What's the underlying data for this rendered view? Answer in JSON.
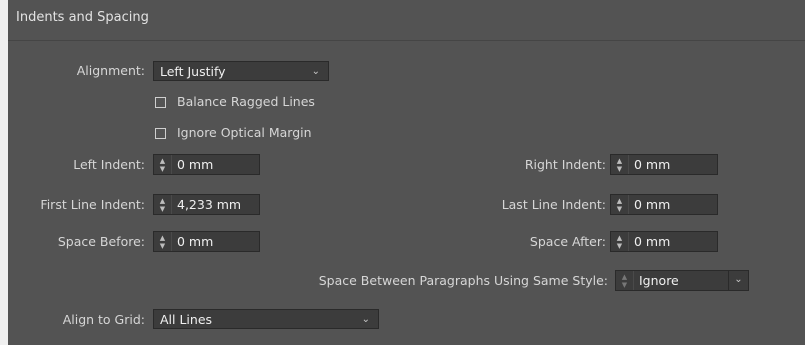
{
  "section": {
    "title": "Indents and Spacing"
  },
  "alignment": {
    "label": "Alignment:",
    "value": "Left Justify"
  },
  "balance_ragged": {
    "label": "Balance Ragged Lines",
    "checked": false
  },
  "ignore_optical": {
    "label": "Ignore Optical Margin",
    "checked": false
  },
  "left_indent": {
    "label": "Left Indent:",
    "value": "0 mm"
  },
  "right_indent": {
    "label": "Right Indent:",
    "value": "0 mm"
  },
  "first_line_indent": {
    "label": "First Line Indent:",
    "value": "4,233 mm"
  },
  "last_line_indent": {
    "label": "Last Line Indent:",
    "value": "0 mm"
  },
  "space_before": {
    "label": "Space Before:",
    "value": "0 mm"
  },
  "space_after": {
    "label": "Space After:",
    "value": "0 mm"
  },
  "space_between": {
    "label": "Space Between Paragraphs Using Same Style:",
    "value": "Ignore"
  },
  "align_to_grid": {
    "label": "Align to Grid:",
    "value": "All Lines"
  },
  "colors": {
    "panel_bg": "#535353",
    "field_bg": "#3c3c3c",
    "page_bg": "#f0f0f0"
  }
}
